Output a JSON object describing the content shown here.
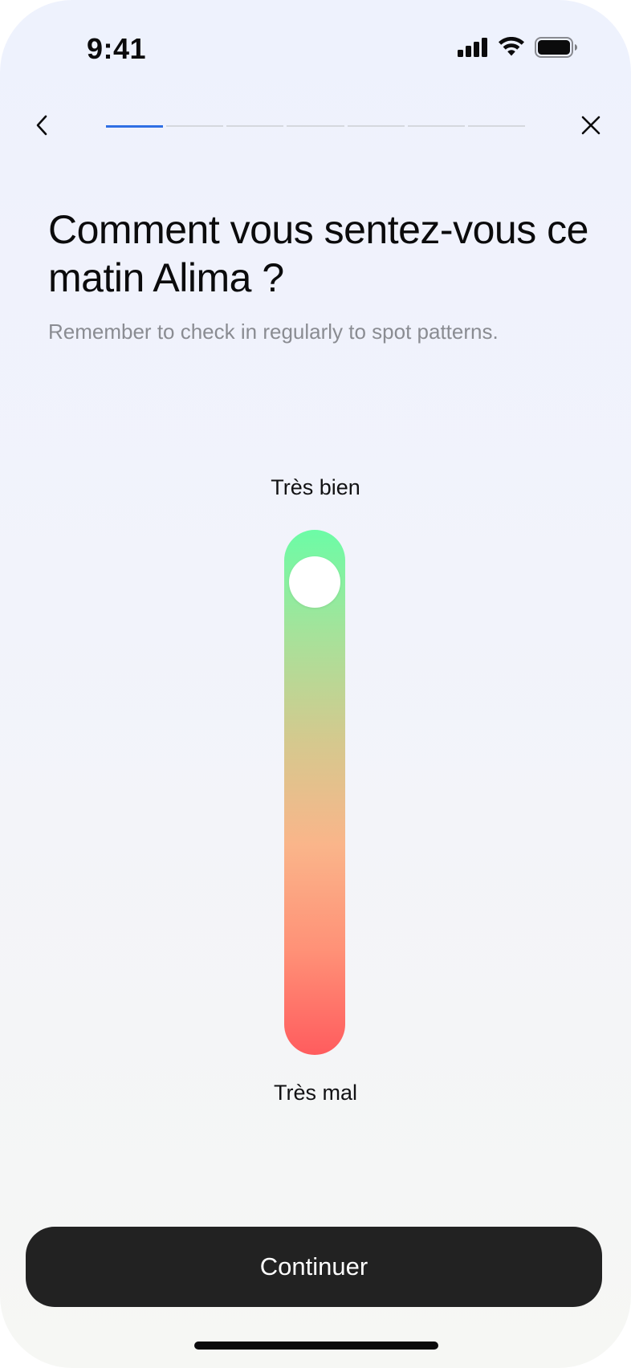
{
  "status_bar": {
    "time": "9:41",
    "icons": [
      "cellular-signal-icon",
      "wifi-icon",
      "battery-icon"
    ]
  },
  "navigation": {
    "back_icon": "chevron-left-icon",
    "close_icon": "close-icon",
    "progress": {
      "total_steps": 7,
      "current_step": 1,
      "active_color": "#2f6fe4",
      "inactive_color": "#d5d8de"
    }
  },
  "content": {
    "title": "Comment vous sentez-vous ce matin Alima ?",
    "subtitle": "Remember to check in regularly to spot patterns."
  },
  "mood_slider": {
    "label_top": "Très bien",
    "label_bottom": "Très mal",
    "value": 0.95,
    "gradient_colors": [
      "#6cfca6",
      "#a6e29a",
      "#d4c98e",
      "#fab58a",
      "#ff9177",
      "#ff5c5e"
    ]
  },
  "actions": {
    "continue_label": "Continuer"
  },
  "colors": {
    "button_background": "#222222",
    "button_text": "#ffffff",
    "subtitle_text": "#8a8c92"
  }
}
